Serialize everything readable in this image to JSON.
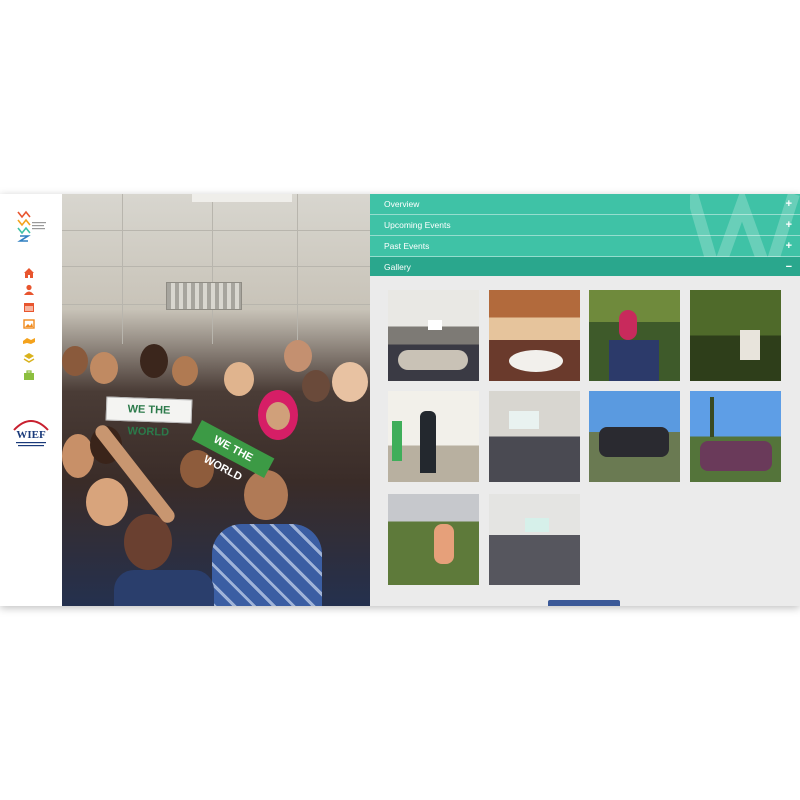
{
  "accordion": {
    "items": [
      {
        "label": "Overview",
        "sign": "+"
      },
      {
        "label": "Upcoming Events",
        "sign": "+"
      },
      {
        "label": "Past Events",
        "sign": "+"
      },
      {
        "label": "Gallery",
        "sign": "−"
      }
    ]
  },
  "hero": {
    "banner_we_text": "WE THE WORLD",
    "banner_green_text": "WE THE WORLD"
  },
  "sidebar": {
    "nav_icons": [
      "home-icon",
      "user-icon",
      "calendar-icon",
      "image-icon",
      "handshake-icon",
      "layers-icon",
      "briefcase-icon"
    ]
  },
  "colors": {
    "accent": "#3fc2a6",
    "accent_active": "#2aa78d",
    "panel_bg": "#ebebeb",
    "icon": "#e8552e"
  },
  "gallery": {
    "thumbnails": [
      "conference-hall-photo",
      "dinner-table-photo",
      "group-outdoor-photo",
      "forest-group-photo",
      "speaker-podium-photo",
      "presentation-room-photo",
      "beach-gathering-photo",
      "palm-tree-group-photo",
      "lawn-group-photo",
      "seminar-screen-photo"
    ]
  }
}
